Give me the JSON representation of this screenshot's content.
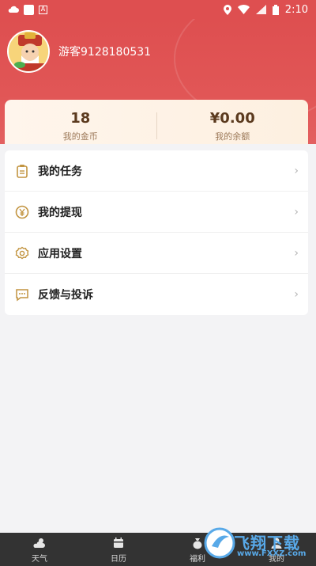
{
  "statusbar": {
    "time": "2:10"
  },
  "profile": {
    "username": "游客9128180531"
  },
  "stats": [
    {
      "value": "18",
      "label": "我的金币"
    },
    {
      "value": "¥0.00",
      "label": "我的余额"
    }
  ],
  "menu": [
    {
      "label": "我的任务",
      "icon": "clipboard-icon"
    },
    {
      "label": "我的提现",
      "icon": "yuan-coin-icon"
    },
    {
      "label": "应用设置",
      "icon": "gear-icon"
    },
    {
      "label": "反馈与投诉",
      "icon": "chat-bubble-icon"
    }
  ],
  "nav": [
    {
      "label": "天气",
      "icon": "weather-icon"
    },
    {
      "label": "日历",
      "icon": "calendar-icon"
    },
    {
      "label": "福利",
      "icon": "money-bag-icon"
    },
    {
      "label": "我的",
      "icon": "user-icon"
    }
  ],
  "watermark": {
    "text": "飞翔下载",
    "sub": "www.FXXZ.com"
  },
  "colors": {
    "header": "#de4f50",
    "accent_gold": "#c29440",
    "nav_bg": "#333333"
  }
}
